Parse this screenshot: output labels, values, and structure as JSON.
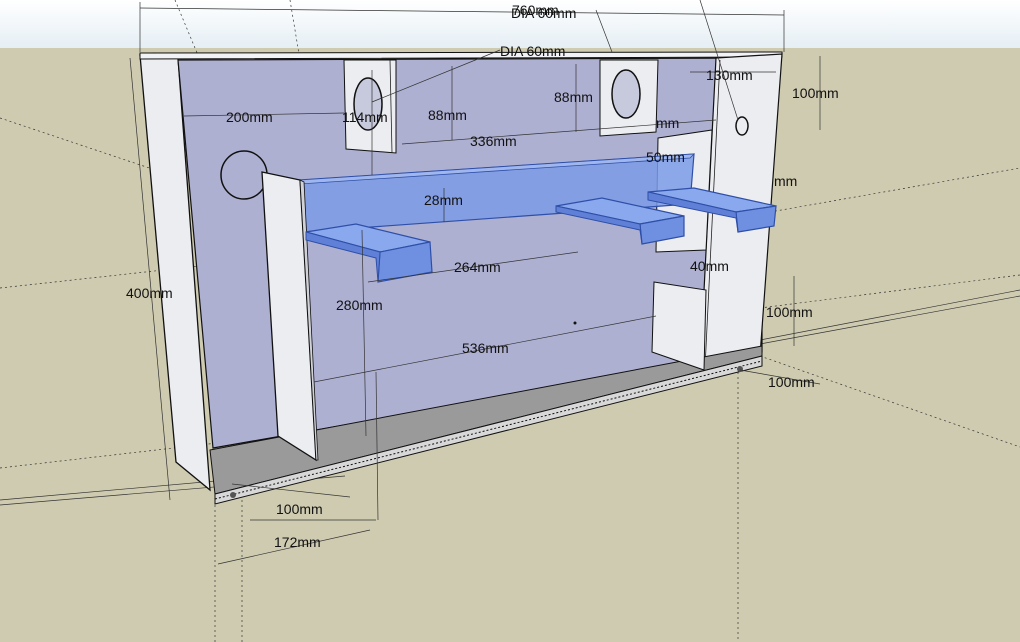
{
  "dimensions": {
    "overall_width": "760mm",
    "top_overlay": "DIA 60mm",
    "dia_top": "DIA 60mm",
    "back_width": "200mm",
    "port_offset": "114mm",
    "port_drop_left": "88mm",
    "port_drop_right": "88mm",
    "port_spacing": "336mm",
    "right_inset": "130mm",
    "right_height": "100mm",
    "shelf_depth": "50mm",
    "right_clip": "mm",
    "clip_top": "mm",
    "brace_height": "28mm",
    "brace_span": "264mm",
    "inner_depth": "40mm",
    "height_total": "400mm",
    "divider_height": "280mm",
    "inner_width": "536mm",
    "foot_height": "100mm",
    "foot_depth": "100mm",
    "base_offset": "100mm",
    "base_depth": "172mm"
  },
  "colors": {
    "sky": "#ffffff",
    "ground": "#cfcbb0",
    "back_panel": "#aeb0d2",
    "panel_white": "#ecedf1",
    "floor": "#9a9a9a",
    "brace_blue": "#7b9be6",
    "brace_dark": "#4a6fcf"
  }
}
